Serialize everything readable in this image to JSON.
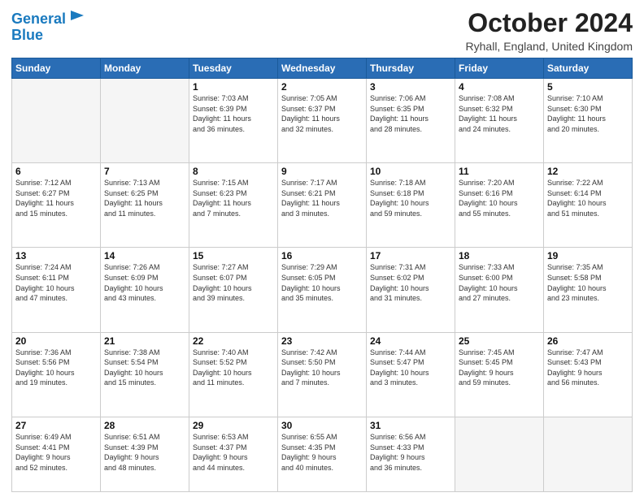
{
  "logo": {
    "line1": "General",
    "line2": "Blue"
  },
  "title": "October 2024",
  "location": "Ryhall, England, United Kingdom",
  "days_header": [
    "Sunday",
    "Monday",
    "Tuesday",
    "Wednesday",
    "Thursday",
    "Friday",
    "Saturday"
  ],
  "weeks": [
    [
      {
        "num": "",
        "info": ""
      },
      {
        "num": "",
        "info": ""
      },
      {
        "num": "1",
        "info": "Sunrise: 7:03 AM\nSunset: 6:39 PM\nDaylight: 11 hours\nand 36 minutes."
      },
      {
        "num": "2",
        "info": "Sunrise: 7:05 AM\nSunset: 6:37 PM\nDaylight: 11 hours\nand 32 minutes."
      },
      {
        "num": "3",
        "info": "Sunrise: 7:06 AM\nSunset: 6:35 PM\nDaylight: 11 hours\nand 28 minutes."
      },
      {
        "num": "4",
        "info": "Sunrise: 7:08 AM\nSunset: 6:32 PM\nDaylight: 11 hours\nand 24 minutes."
      },
      {
        "num": "5",
        "info": "Sunrise: 7:10 AM\nSunset: 6:30 PM\nDaylight: 11 hours\nand 20 minutes."
      }
    ],
    [
      {
        "num": "6",
        "info": "Sunrise: 7:12 AM\nSunset: 6:27 PM\nDaylight: 11 hours\nand 15 minutes."
      },
      {
        "num": "7",
        "info": "Sunrise: 7:13 AM\nSunset: 6:25 PM\nDaylight: 11 hours\nand 11 minutes."
      },
      {
        "num": "8",
        "info": "Sunrise: 7:15 AM\nSunset: 6:23 PM\nDaylight: 11 hours\nand 7 minutes."
      },
      {
        "num": "9",
        "info": "Sunrise: 7:17 AM\nSunset: 6:21 PM\nDaylight: 11 hours\nand 3 minutes."
      },
      {
        "num": "10",
        "info": "Sunrise: 7:18 AM\nSunset: 6:18 PM\nDaylight: 10 hours\nand 59 minutes."
      },
      {
        "num": "11",
        "info": "Sunrise: 7:20 AM\nSunset: 6:16 PM\nDaylight: 10 hours\nand 55 minutes."
      },
      {
        "num": "12",
        "info": "Sunrise: 7:22 AM\nSunset: 6:14 PM\nDaylight: 10 hours\nand 51 minutes."
      }
    ],
    [
      {
        "num": "13",
        "info": "Sunrise: 7:24 AM\nSunset: 6:11 PM\nDaylight: 10 hours\nand 47 minutes."
      },
      {
        "num": "14",
        "info": "Sunrise: 7:26 AM\nSunset: 6:09 PM\nDaylight: 10 hours\nand 43 minutes."
      },
      {
        "num": "15",
        "info": "Sunrise: 7:27 AM\nSunset: 6:07 PM\nDaylight: 10 hours\nand 39 minutes."
      },
      {
        "num": "16",
        "info": "Sunrise: 7:29 AM\nSunset: 6:05 PM\nDaylight: 10 hours\nand 35 minutes."
      },
      {
        "num": "17",
        "info": "Sunrise: 7:31 AM\nSunset: 6:02 PM\nDaylight: 10 hours\nand 31 minutes."
      },
      {
        "num": "18",
        "info": "Sunrise: 7:33 AM\nSunset: 6:00 PM\nDaylight: 10 hours\nand 27 minutes."
      },
      {
        "num": "19",
        "info": "Sunrise: 7:35 AM\nSunset: 5:58 PM\nDaylight: 10 hours\nand 23 minutes."
      }
    ],
    [
      {
        "num": "20",
        "info": "Sunrise: 7:36 AM\nSunset: 5:56 PM\nDaylight: 10 hours\nand 19 minutes."
      },
      {
        "num": "21",
        "info": "Sunrise: 7:38 AM\nSunset: 5:54 PM\nDaylight: 10 hours\nand 15 minutes."
      },
      {
        "num": "22",
        "info": "Sunrise: 7:40 AM\nSunset: 5:52 PM\nDaylight: 10 hours\nand 11 minutes."
      },
      {
        "num": "23",
        "info": "Sunrise: 7:42 AM\nSunset: 5:50 PM\nDaylight: 10 hours\nand 7 minutes."
      },
      {
        "num": "24",
        "info": "Sunrise: 7:44 AM\nSunset: 5:47 PM\nDaylight: 10 hours\nand 3 minutes."
      },
      {
        "num": "25",
        "info": "Sunrise: 7:45 AM\nSunset: 5:45 PM\nDaylight: 9 hours\nand 59 minutes."
      },
      {
        "num": "26",
        "info": "Sunrise: 7:47 AM\nSunset: 5:43 PM\nDaylight: 9 hours\nand 56 minutes."
      }
    ],
    [
      {
        "num": "27",
        "info": "Sunrise: 6:49 AM\nSunset: 4:41 PM\nDaylight: 9 hours\nand 52 minutes."
      },
      {
        "num": "28",
        "info": "Sunrise: 6:51 AM\nSunset: 4:39 PM\nDaylight: 9 hours\nand 48 minutes."
      },
      {
        "num": "29",
        "info": "Sunrise: 6:53 AM\nSunset: 4:37 PM\nDaylight: 9 hours\nand 44 minutes."
      },
      {
        "num": "30",
        "info": "Sunrise: 6:55 AM\nSunset: 4:35 PM\nDaylight: 9 hours\nand 40 minutes."
      },
      {
        "num": "31",
        "info": "Sunrise: 6:56 AM\nSunset: 4:33 PM\nDaylight: 9 hours\nand 36 minutes."
      },
      {
        "num": "",
        "info": ""
      },
      {
        "num": "",
        "info": ""
      }
    ]
  ]
}
